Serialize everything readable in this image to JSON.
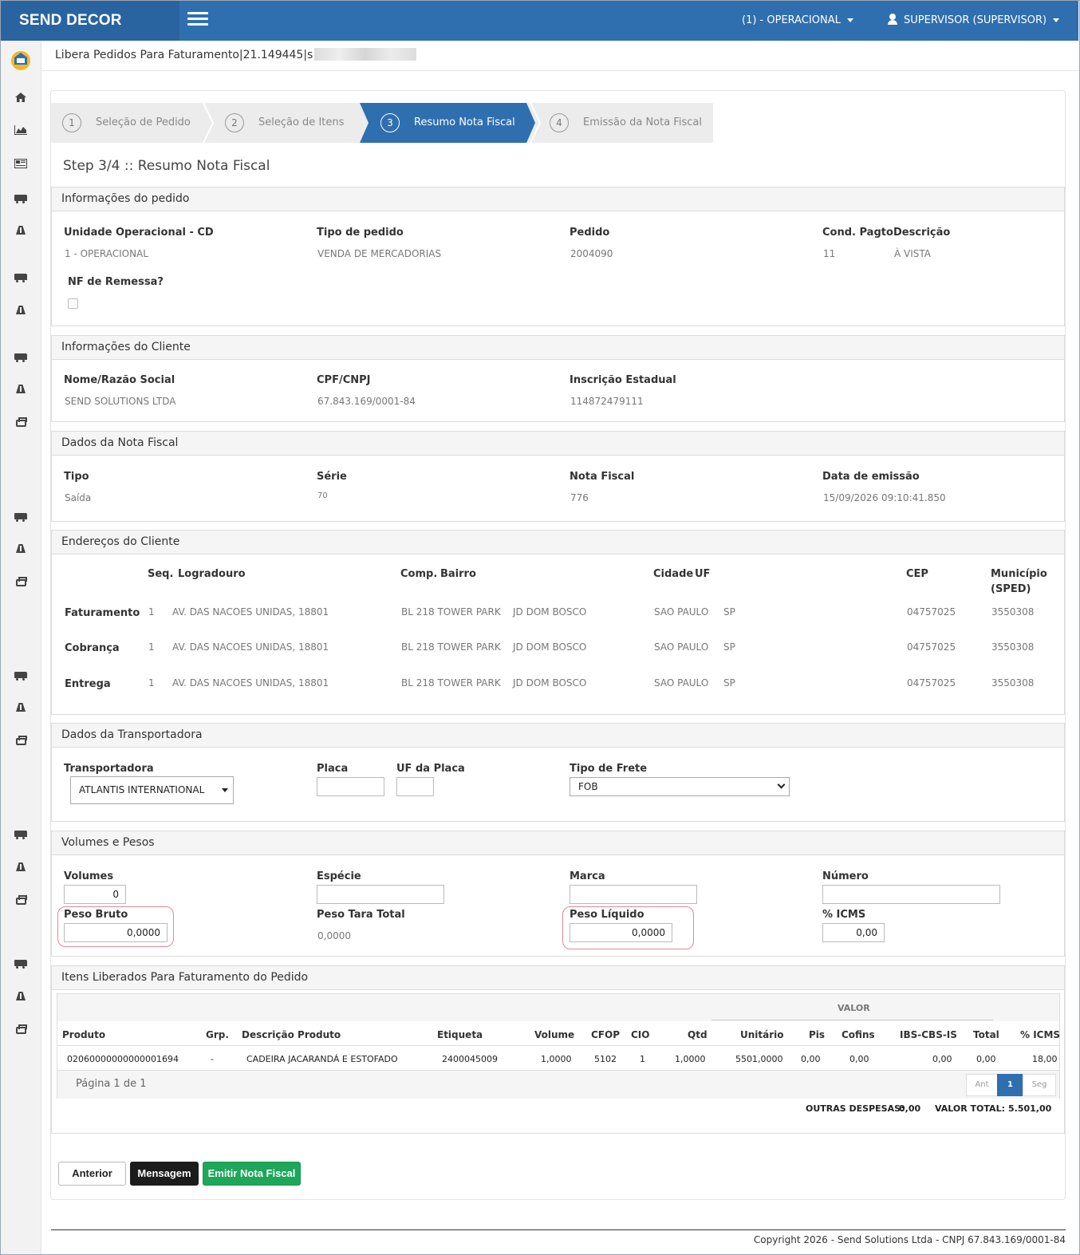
{
  "header": {
    "brand": "SEND DECOR",
    "unit_menu": "(1) - OPERACIONAL",
    "user_menu": "SUPERVISOR (SUPERVISOR)"
  },
  "page": {
    "title": "Libera Pedidos Para Faturamento|21.149445|s"
  },
  "wizard": {
    "steps": [
      {
        "num": "1",
        "label": "Seleção de Pedido"
      },
      {
        "num": "2",
        "label": "Seleção de Itens"
      },
      {
        "num": "3",
        "label": "Resumo Nota Fiscal"
      },
      {
        "num": "4",
        "label": "Emissão da Nota Fiscal"
      }
    ],
    "active_step": 3,
    "heading": "Step 3/4 :: Resumo Nota Fiscal"
  },
  "pedido": {
    "title": "Informações do pedido",
    "unidade_label": "Unidade Operacional - CD",
    "unidade_value": "1 - OPERACIONAL",
    "tipo_label": "Tipo de pedido",
    "tipo_value": "VENDA DE MERCADORIAS",
    "pedido_label": "Pedido",
    "pedido_value": "2004090",
    "cond_label": "Cond. Pagto",
    "cond_value": "11",
    "desc_label": "Descrição",
    "desc_value": "À VISTA",
    "remessa_label": "NF de Remessa?",
    "remessa_checked": false
  },
  "cliente": {
    "title": "Informações do Cliente",
    "nome_label": "Nome/Razão Social",
    "nome_value": "SEND SOLUTIONS LTDA",
    "cnpj_label": "CPF/CNPJ",
    "cnpj_value": "67.843.169/0001-84",
    "ie_label": "Inscrição Estadual",
    "ie_value": "114872479111"
  },
  "nota": {
    "title": "Dados da Nota Fiscal",
    "tipo_label": "Tipo",
    "tipo_value": "Saída",
    "serie_label": "Série",
    "serie_value": "70",
    "nf_label": "Nota Fiscal",
    "nf_value": "776",
    "data_label": "Data de emissão",
    "data_value": "15/09/2026 09:10:41.850"
  },
  "enderecos": {
    "title": "Endereços do Cliente",
    "headers": {
      "seq": "Seq.",
      "logradouro": "Logradouro",
      "comp": "Comp.",
      "bairro": "Bairro",
      "cidade": "Cidade",
      "uf": "UF",
      "cep": "CEP",
      "municipio_1": "Município",
      "municipio_2": "(SPED)"
    },
    "rows": [
      {
        "tipo": "Faturamento",
        "seq": "1",
        "logradouro": "AV. DAS NACOES UNIDAS, 18801",
        "comp": "BL 218 TOWER PARK",
        "bairro": "JD DOM BOSCO",
        "cidade": "SAO PAULO",
        "uf": "SP",
        "cep": "04757025",
        "municipio": "3550308"
      },
      {
        "tipo": "Cobrança",
        "seq": "1",
        "logradouro": "AV. DAS NACOES UNIDAS, 18801",
        "comp": "BL 218 TOWER PARK",
        "bairro": "JD DOM BOSCO",
        "cidade": "SAO PAULO",
        "uf": "SP",
        "cep": "04757025",
        "municipio": "3550308"
      },
      {
        "tipo": "Entrega",
        "seq": "1",
        "logradouro": "AV. DAS NACOES UNIDAS, 18801",
        "comp": "BL 218 TOWER PARK",
        "bairro": "JD DOM BOSCO",
        "cidade": "SAO PAULO",
        "uf": "SP",
        "cep": "04757025",
        "municipio": "3550308"
      }
    ]
  },
  "transportadora": {
    "title": "Dados da Transportadora",
    "transp_label": "Transportadora",
    "transp_value": "ATLANTIS INTERNATIONAL",
    "placa_label": "Placa",
    "placa_value": "",
    "uf_label": "UF da Placa",
    "uf_value": "",
    "frete_label": "Tipo de Frete",
    "frete_value": "FOB"
  },
  "volumes": {
    "title": "Volumes e Pesos",
    "volumes_label": "Volumes",
    "volumes_value": "0",
    "especie_label": "Espécie",
    "especie_value": "",
    "marca_label": "Marca",
    "marca_value": "",
    "numero_label": "Número",
    "numero_value": "",
    "peso_bruto_label": "Peso Bruto",
    "peso_bruto_value": "0,0000",
    "peso_tara_label": "Peso Tara Total",
    "peso_tara_value": "0,0000",
    "peso_liquido_label": "Peso Líquido",
    "peso_liquido_value": "0,0000",
    "icms_label": "% ICMS",
    "icms_value": "0,00"
  },
  "itens": {
    "title": "Itens Liberados Para Faturamento do Pedido",
    "group_header": "VALOR",
    "headers": {
      "produto": "Produto",
      "grp": "Grp.",
      "descricao": "Descrição Produto",
      "etiqueta": "Etiqueta",
      "volume": "Volume",
      "cfop": "CFOP",
      "cio": "CIO",
      "qtd": "Qtd",
      "unitario": "Unitário",
      "pis": "Pis",
      "cofins": "Cofins",
      "ibs": "IBS-CBS-IS",
      "total": "Total",
      "icms": "% ICMS"
    },
    "rows": [
      {
        "produto": "02060000000000001694",
        "grp": "-",
        "descricao": "CADEIRA JACARANDÁ E ESTOFADO",
        "etiqueta": "2400045009",
        "volume": "1,0000",
        "cfop": "5102",
        "cio": "1",
        "qtd": "1,0000",
        "unitario": "5501,0000",
        "pis": "0,00",
        "cofins": "0,00",
        "ibs": "0,00",
        "total": "0,00",
        "icms": "18,00"
      }
    ],
    "pagination": "Página 1 de 1",
    "pager": {
      "prev": "Ant",
      "current": "1",
      "next": "Seg"
    },
    "outras_label": "OUTRAS DESPESAS:",
    "outras_value": "0,00",
    "total_label": "VALOR TOTAL:",
    "total_value": "5.501,00"
  },
  "actions": {
    "anterior": "Anterior",
    "mensagem": "Mensagem",
    "emitir": "Emitir Nota Fiscal"
  },
  "footer": {
    "copyright": "Copyright 2026 - Send Solutions Ltda - CNPJ 67.843.169/0001-84"
  },
  "colors": {
    "header_blue": "#2f6fb0",
    "brand_blue": "#2a64a0",
    "primary_green": "#1ea65a",
    "dark_button": "#1c1c1c",
    "highlight_red": "#e08a95"
  }
}
